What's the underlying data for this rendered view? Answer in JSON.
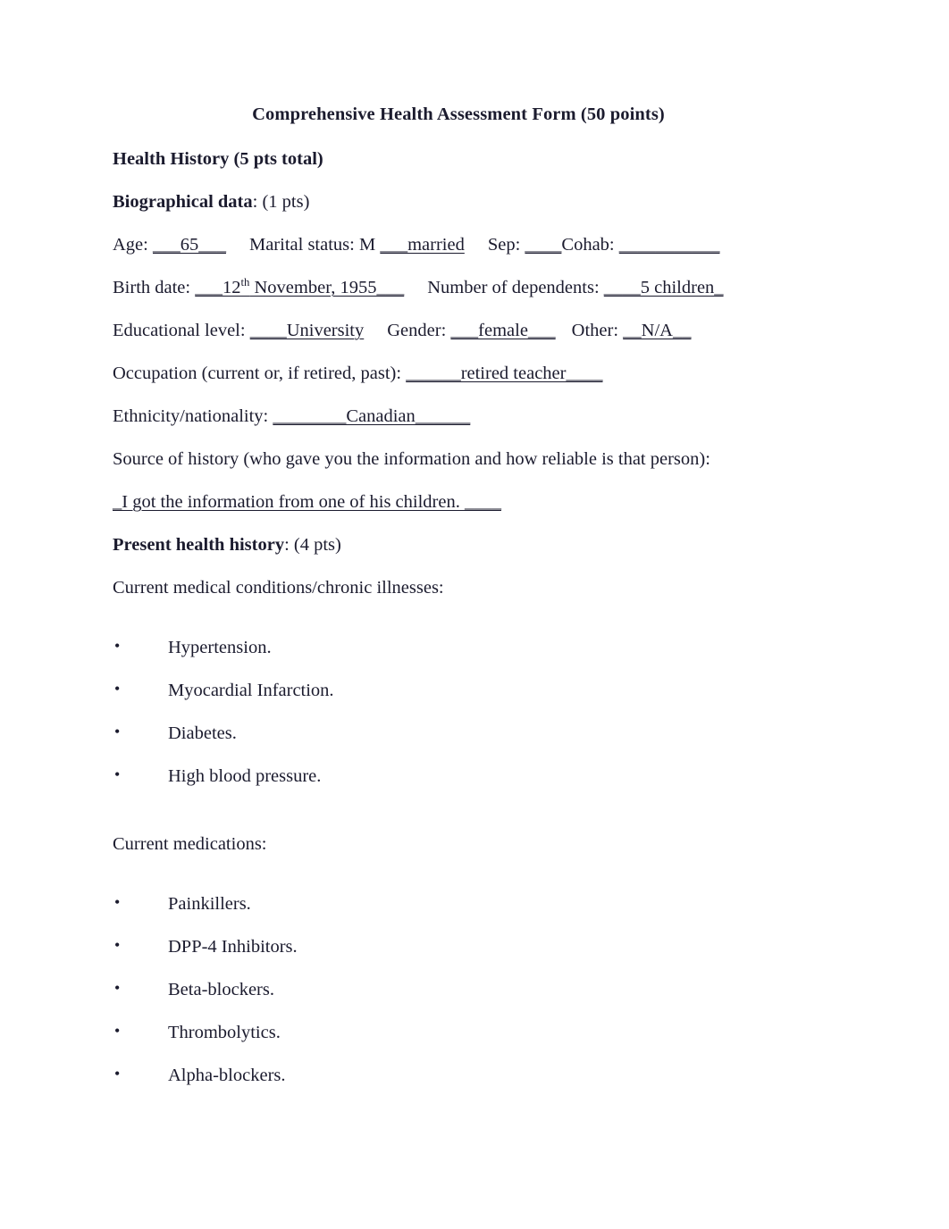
{
  "document": {
    "title": "Comprehensive Health Assessment Form (50 points)",
    "section_health_history": "Health History (5 pts total)",
    "biographical": {
      "heading_label": "Biographical data",
      "heading_points": ": (1 pts)",
      "age_label": "Age: ",
      "age_value": "___65___",
      "marital_label": "Marital status: M ",
      "marital_value": "___married",
      "sep_label": "Sep: ",
      "sep_value": "____",
      "cohab_label": "Cohab: ",
      "cohab_value": "___________",
      "birth_label": "Birth date: ",
      "birth_value_pre": "___12",
      "birth_value_sup": "th",
      "birth_value_post": " November, 1955___",
      "dependents_label": "Number of dependents: ",
      "dependents_value": "____5 children_",
      "education_label": "Educational level: ",
      "education_value": "____University",
      "gender_label": "Gender: ",
      "gender_value": "___female___",
      "other_label": "Other: ",
      "other_value": "__N/A__",
      "occupation_label": "Occupation (current or, if retired, past): ",
      "occupation_value": "______retired teacher____",
      "ethnicity_label": "Ethnicity/nationality: ",
      "ethnicity_value": "________Canadian______",
      "source_prompt": "Source of history (who gave you the information and how reliable is that person):",
      "source_value": "_I got the information from one of his children. ____"
    },
    "present_health": {
      "heading_label": "Present health history",
      "heading_points": ": (4 pts)",
      "conditions_prompt": "Current medical conditions/chronic illnesses:",
      "conditions": [
        "Hypertension.",
        "Myocardial Infarction.",
        "Diabetes.",
        "High blood pressure."
      ],
      "medications_prompt": "Current medications:",
      "medications": [
        "Painkillers.",
        "DPP-4 Inhibitors.",
        "Beta-blockers.",
        "Thrombolytics.",
        "Alpha-blockers."
      ]
    }
  }
}
